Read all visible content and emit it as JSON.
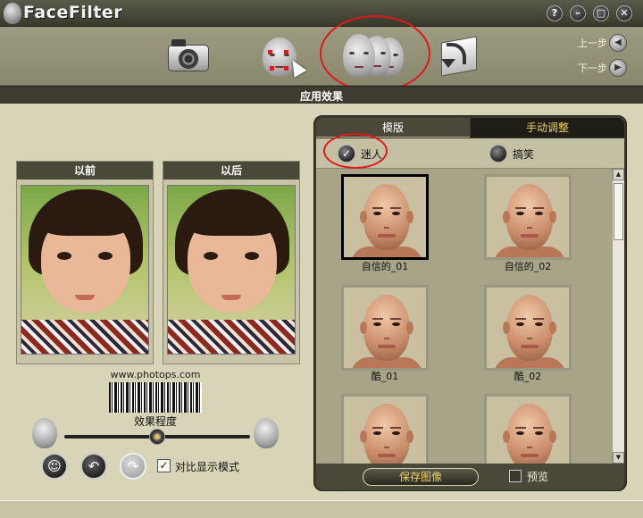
{
  "app": {
    "title_face": "Face",
    "title_filter": "Filter",
    "window_buttons": {
      "help": "?",
      "minimize": "–",
      "maximize": "□",
      "close": "✕"
    }
  },
  "toolbar": {
    "tools": [
      {
        "name": "camera",
        "icon": "camera-icon"
      },
      {
        "name": "face-select",
        "icon": "face-selection-icon"
      },
      {
        "name": "apply-effect",
        "icon": "face-morph-icon",
        "active": true
      },
      {
        "name": "export",
        "icon": "export-arrow-icon"
      }
    ],
    "prev_label": "上一步",
    "next_label": "下一步"
  },
  "section": {
    "title": "应用效果"
  },
  "before": {
    "label": "以前"
  },
  "after": {
    "label": "以后"
  },
  "watermark": "www.photops.com",
  "effect": {
    "slider_label": "效果程度",
    "level": 0.5,
    "compare_checked": true,
    "compare_label": "对比显示模式",
    "check_mark": "✓"
  },
  "tabs": [
    {
      "label": "模版",
      "active": true
    },
    {
      "label": "手动调整",
      "active": false
    }
  ],
  "modes": [
    {
      "label": "迷人",
      "selected": true
    },
    {
      "label": "搞笑",
      "selected": false
    }
  ],
  "templates": [
    {
      "label": "自信的_01",
      "selected": true
    },
    {
      "label": "自信的_02",
      "selected": false
    },
    {
      "label": "酷_01",
      "selected": false
    },
    {
      "label": "酷_02",
      "selected": false
    },
    {
      "label": "",
      "selected": false
    },
    {
      "label": "",
      "selected": false
    }
  ],
  "actions": {
    "save_label": "保存图像",
    "preview_label": "预览",
    "preview_checked": false
  },
  "colors": {
    "accent_red": "#e01818",
    "tab_text_gold": "#f0d060",
    "panel_dark": "#3a382c"
  }
}
